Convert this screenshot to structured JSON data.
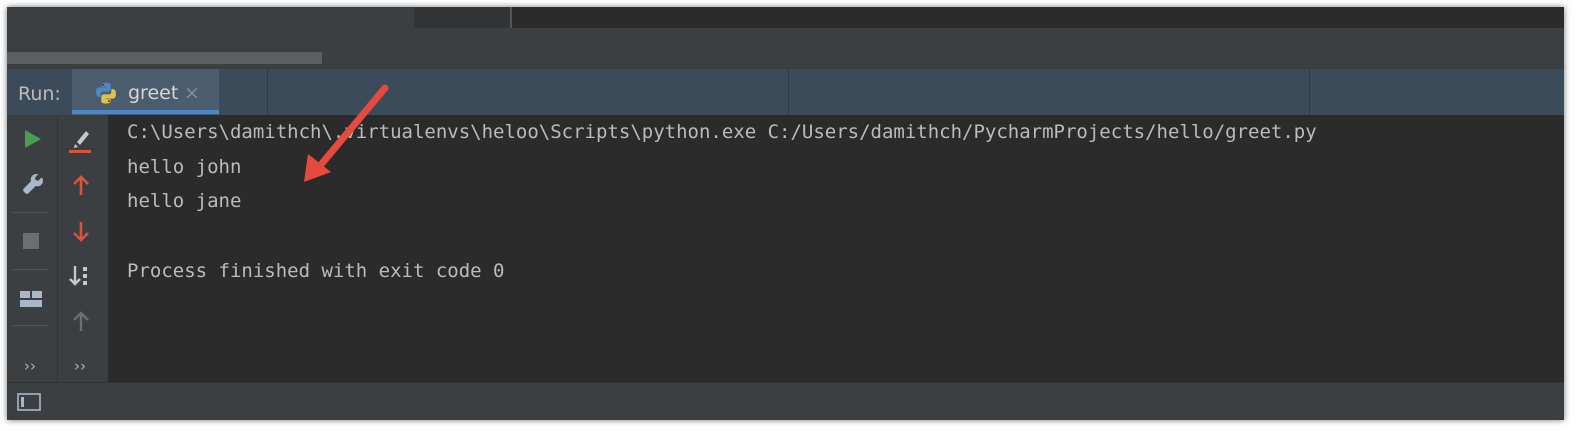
{
  "run_panel": {
    "label": "Run:",
    "tab": {
      "label": "greet",
      "close_glyph": "×",
      "icon": "python-icon"
    }
  },
  "console": {
    "lines": [
      "C:\\Users\\damithch\\.virtualenvs\\heloo\\Scripts\\python.exe C:/Users/damithch/PycharmProjects/hello/greet.py",
      "hello john",
      "hello jane",
      "",
      "Process finished with exit code 0"
    ]
  },
  "toolbar": {
    "more_glyph": "››",
    "actions_primary": [
      "run-icon",
      "wrench-icon",
      "stop-icon",
      "layout-icon"
    ],
    "actions_secondary": [
      "clear-icon",
      "up-arrow-icon",
      "down-arrow-icon",
      "sort-icon",
      "up-arrow-disabled-icon"
    ]
  },
  "colors": {
    "accent": "#4a88c7",
    "run_green": "#499c54",
    "arrow_red": "#e6493e",
    "console_text": "#bbbbbb",
    "background": "#2b2b2b"
  }
}
